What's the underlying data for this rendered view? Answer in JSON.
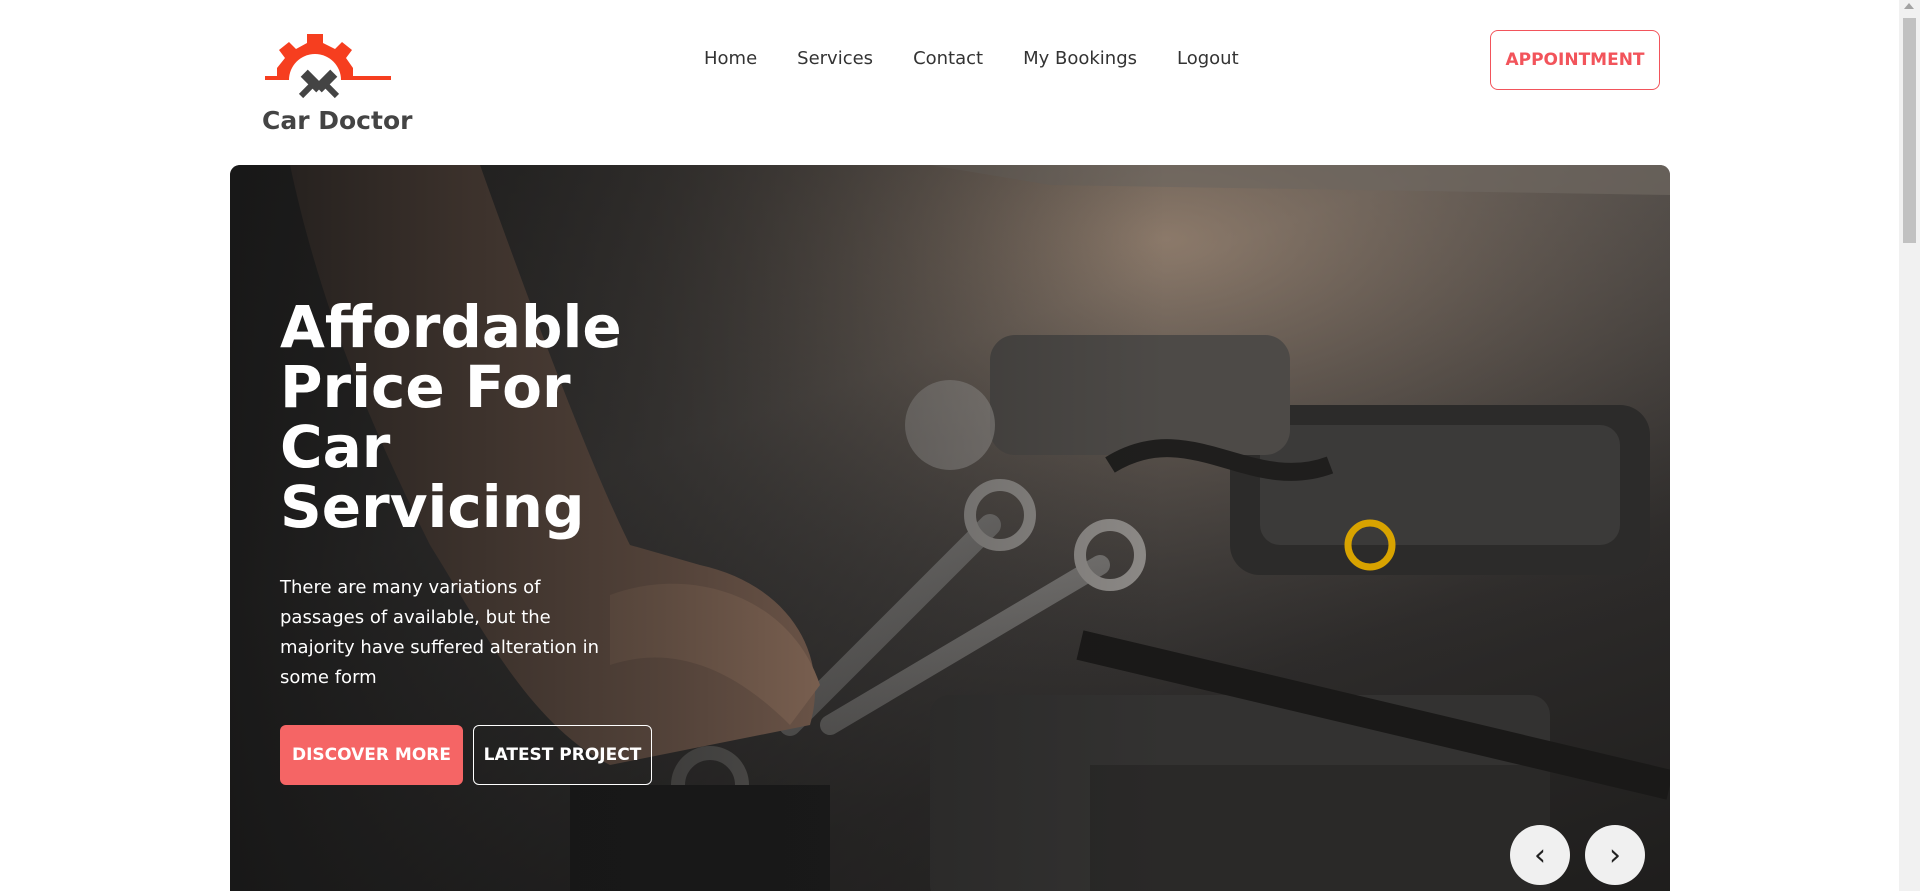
{
  "brand": {
    "name": "Car Doctor",
    "logo_color": "#f63e1f"
  },
  "nav": {
    "items": [
      "Home",
      "Services",
      "Contact",
      "My Bookings",
      "Logout"
    ]
  },
  "header": {
    "appointment_label": "APPOINTMENT"
  },
  "hero": {
    "title": "Affordable Price For Car Servicing",
    "description": "There are many variations of passages of available, but the majority have suffered alteration in some form",
    "primary_button": "DISCOVER MORE",
    "secondary_button": "LATEST PROJECT",
    "prev_symbol": "‹",
    "next_symbol": "›",
    "accent_color": "#f56565"
  }
}
